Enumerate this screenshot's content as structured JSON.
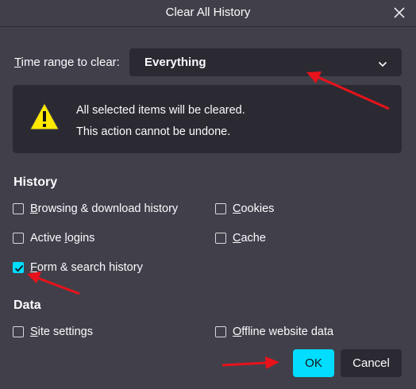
{
  "window": {
    "title": "Clear All History"
  },
  "time_range": {
    "label_accesskey": "T",
    "label_rest": "ime range to clear:",
    "selected": "Everything"
  },
  "warning": {
    "line1": "All selected items will be cleared.",
    "line2": "This action cannot be undone."
  },
  "history": {
    "heading": "History",
    "items": [
      {
        "key": "B",
        "rest": "rowsing & download history",
        "checked": false
      },
      {
        "key": "C",
        "rest": "ookies",
        "checked": false
      },
      {
        "key": "",
        "pre": "Active ",
        "keymid": "l",
        "rest": "ogins",
        "checked": false
      },
      {
        "key": "C",
        "pre": "",
        "keymid": "",
        "rest": "ache",
        "checked": false
      },
      {
        "key": "F",
        "rest": "orm & search history",
        "checked": true
      }
    ]
  },
  "data_section": {
    "heading": "Data",
    "items": [
      {
        "key": "S",
        "rest": "ite settings",
        "checked": false
      },
      {
        "key": "O",
        "rest": "ffline website data",
        "checked": false
      }
    ]
  },
  "buttons": {
    "ok": "OK",
    "cancel": "Cancel"
  },
  "colors": {
    "accent": "#00ddff",
    "annotation": "#e8121a",
    "background": "#41404a",
    "panel": "#2b2a33"
  },
  "icons": [
    "close-icon",
    "chevron-down-icon",
    "warning-icon",
    "checkmark-icon"
  ]
}
